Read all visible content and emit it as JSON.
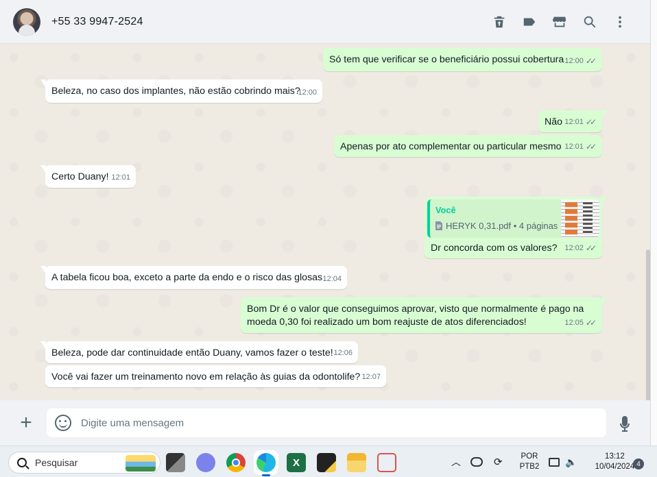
{
  "header": {
    "contact_name": "+55 33 9947-2524",
    "actions": [
      {
        "icon": "trash-icon"
      },
      {
        "icon": "label-icon"
      },
      {
        "icon": "store-icon"
      },
      {
        "icon": "search-icon"
      },
      {
        "icon": "more-options-icon"
      }
    ]
  },
  "messages": [
    {
      "direction": "out",
      "text": "Só tem que verificar se o beneficiário possui cobertura",
      "time": "12:00",
      "status": "read"
    },
    {
      "direction": "in",
      "text": "Beleza, no caso dos implantes, não estão cobrindo mais?",
      "time": "12:00"
    },
    {
      "direction": "out",
      "text": "Não",
      "time": "12:01",
      "status": "read"
    },
    {
      "direction": "out",
      "text": "Apenas por ato complementar ou particular mesmo",
      "time": "12:01",
      "status": "read"
    },
    {
      "direction": "in",
      "text": "Certo Duany!",
      "time": "12:01"
    },
    {
      "direction": "out",
      "quote": {
        "author": "Você",
        "file": "HERYK 0,31.pdf • 4 páginas"
      },
      "text": "Dr concorda com os valores?",
      "time": "12:02",
      "status": "read"
    },
    {
      "direction": "in",
      "text": "A tabela ficou boa, exceto a parte da endo e o risco das glosas",
      "time": "12:04"
    },
    {
      "direction": "out",
      "text": "Bom Dr é o valor que conseguimos aprovar, visto que normalmente é pago na moeda 0,30 foi realizado um bom reajuste de atos diferenciados!",
      "time": "12:05",
      "status": "read"
    },
    {
      "direction": "in",
      "text": "Beleza, pode dar continuidade então Duany, vamos fazer o teste!",
      "time": "12:06"
    },
    {
      "direction": "in",
      "text": "Você vai fazer um treinamento novo em relação às guias da odontolife?",
      "time": "12:07"
    }
  ],
  "composer": {
    "placeholder": "Digite uma mensagem"
  },
  "taskbar": {
    "search_label": "Pesquisar",
    "apps": [
      "task-view",
      "teams",
      "chrome",
      "edge",
      "excel",
      "sticky-notes",
      "file-explorer",
      "snipping-tool"
    ],
    "language_line1": "POR",
    "language_line2": "PTB2",
    "time": "13:12",
    "date": "10/04/2024",
    "notification_count": "4"
  },
  "colors": {
    "outgoing_bubble": "#d9fdd3",
    "incoming_bubble": "#ffffff",
    "chat_background": "#efeae2",
    "accent": "#06cf9c"
  }
}
